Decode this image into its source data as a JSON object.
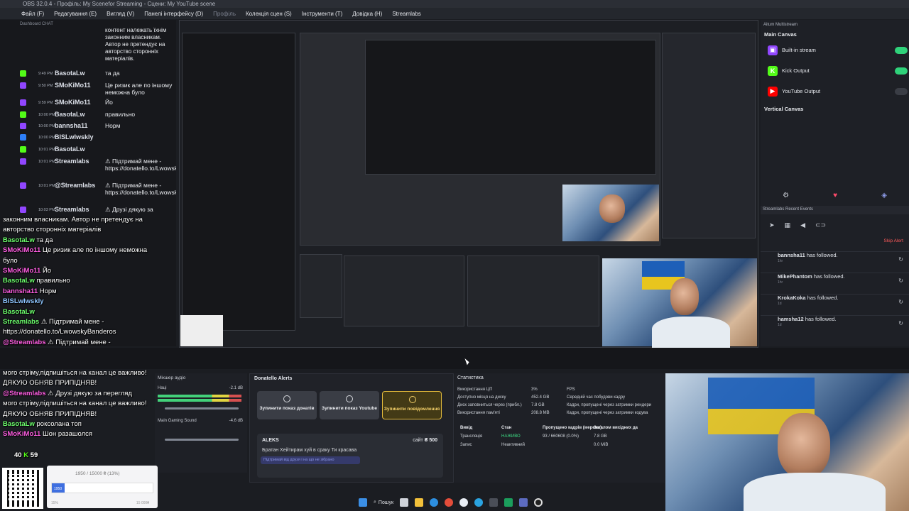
{
  "window": {
    "title": "OBS 32.0.4 - Профіль: My Scenefor Streaming - Сцени: My YouTube scene"
  },
  "menu": {
    "items": [
      "Файл (F)",
      "Редагування (E)",
      "Вигляд (V)",
      "Панелі інтерфейсу (D)",
      "Профіль",
      "Колекція сцен (S)",
      "Інструменти (T)",
      "Довідка (H)",
      "Streamlabs"
    ]
  },
  "chat_dock": {
    "title": "Dashboard CHAT",
    "top_text": "контент належать їхнім законним власникам. Автор не претендує на авторство сторонніх матеріалів.",
    "messages": [
      {
        "time": "9:49 PM",
        "user": "BasotaLw",
        "msg": "та да",
        "icon": "kick"
      },
      {
        "time": "9:50 PM",
        "user": "SMoKiMo11",
        "msg": "Це ризик але по іншому неможна було",
        "icon": "twitch"
      },
      {
        "time": "9:59 PM",
        "user": "SMoKiMo11",
        "msg": "Йо",
        "icon": "twitch"
      },
      {
        "time": "10:00 PM",
        "user": "BasotaLw",
        "msg": "правильно",
        "icon": "kick"
      },
      {
        "time": "10:00 PM",
        "user": "bannsha11",
        "msg": "Норм",
        "icon": "twitch"
      },
      {
        "time": "10:00 PM",
        "user": "BISLwIwskly",
        "msg": "",
        "icon": "blue"
      },
      {
        "time": "10:01 PM",
        "user": "BasotaLw",
        "msg": "",
        "icon": "kick"
      },
      {
        "time": "10:01 PM",
        "user": "Streamlabs",
        "msg": "⚠ Підтримай мене - https://donatello.to/LwowskyBanderos",
        "icon": "twitch"
      },
      {
        "time": "10:01 PM",
        "user": "@Streamlabs",
        "msg": "⚠ Підтримай мене - https://donatello.to/LwowskyBanderos",
        "icon": "twitch"
      },
      {
        "time": "10:03 PM",
        "user": "Streamlabs",
        "msg": "⚠ Друзі дякую за",
        "icon": "twitch"
      }
    ]
  },
  "overlay_chat": {
    "lines": [
      {
        "user": "",
        "msg": "законним власникам. Автор не претендує на",
        "cls": ""
      },
      {
        "user": "",
        "msg": "авторство сторонніх матеріалів",
        "cls": ""
      },
      {
        "user": "BasotaLw",
        "msg": "та да",
        "cls": "g"
      },
      {
        "user": "SMoKiMo11",
        "msg": "Це ризик але по іншому неможна",
        "cls": ""
      },
      {
        "user": "",
        "msg": "було",
        "cls": ""
      },
      {
        "user": "SMoKiMo11",
        "msg": "Йо",
        "cls": ""
      },
      {
        "user": "BasotaLw",
        "msg": "правильно",
        "cls": "g"
      },
      {
        "user": "bannsha11",
        "msg": "Норм",
        "cls": ""
      },
      {
        "user": "BISLwIwskly",
        "msg": "",
        "cls": "b"
      },
      {
        "user": "BasotaLw",
        "msg": "",
        "cls": "g"
      },
      {
        "user": "Streamlabs",
        "msg": "⚠ Підтримай мене -",
        "cls": "g"
      },
      {
        "user": "",
        "msg": "https://donatello.to/LwowskyBanderos",
        "cls": ""
      },
      {
        "user": "@Streamlabs",
        "msg": "⚠ Підтримай мене -",
        "cls": ""
      },
      {
        "user": "",
        "msg": "https://donatello.to/LwowskyBanderos",
        "cls": ""
      },
      {
        "user": "Streamlabs",
        "msg": "⚠ Друзі дякую за перегляд",
        "cls": "g"
      },
      {
        "user": "",
        "msg": "мого стріму,підпишіться на канал це важливо!",
        "cls": ""
      },
      {
        "user": "",
        "msg": "ДЯКУЮ ОБНЯВ ПРИПІДНЯВ!",
        "cls": ""
      },
      {
        "user": "@Streamlabs",
        "msg": "⚠ Друзі дякую за перегляд",
        "cls": ""
      },
      {
        "user": "",
        "msg": "мого стріму,підпишіться на канал це важливо!",
        "cls": ""
      },
      {
        "user": "",
        "msg": "ДЯКУЮ ОБНЯВ ПРИПІДНЯВ!",
        "cls": ""
      },
      {
        "user": "BasotaLw",
        "msg": "роксолана топ",
        "cls": "g"
      },
      {
        "user": "SMoKiMo11",
        "msg": "Шон разашолся",
        "cls": ""
      }
    ],
    "counter_a": "40",
    "counter_b": "59"
  },
  "multistream": {
    "header": "Aitum Multistream",
    "main_canvas": "Main Canvas",
    "outputs": [
      {
        "label": "Built-in stream",
        "icon": "twitch-icon",
        "color": "#9146ff",
        "glyph": "▣"
      },
      {
        "label": "Kick Output",
        "icon": "kick-icon",
        "color": "#53fc18",
        "glyph": "K"
      },
      {
        "label": "YouTube Output",
        "icon": "youtube-icon",
        "color": "#ff0000",
        "glyph": "▶"
      }
    ],
    "vertical_canvas": "Vertical Canvas"
  },
  "recent_events": {
    "header": "Streamlabs Recent Events",
    "skip": "Skip Alert",
    "items": [
      {
        "user": "bannsha11",
        "text": "has followed.",
        "sub": "1hr"
      },
      {
        "user": "MikePhantom",
        "text": "has followed.",
        "sub": "1hr"
      },
      {
        "user": "KrokaKoka",
        "text": "has followed.",
        "sub": "1d"
      },
      {
        "user": "hamsha12",
        "text": "has followed.",
        "sub": "1d"
      }
    ]
  },
  "mixer": {
    "title": "Мікшер аудіо",
    "channels": [
      {
        "name": "Наці",
        "db": "-2.1 dB"
      },
      {
        "name": "Main Gaming Sound",
        "db": "-4.6 dB"
      }
    ]
  },
  "donatello": {
    "title": "Donatello Alerts",
    "buttons": [
      "Зупинити показ донатів",
      "Зупинити показ Youtube",
      "Зупинити повідомлення"
    ],
    "card": {
      "name": "ALEKS",
      "amount_prefix": "сайт",
      "amount": "₴ 500",
      "message": "Братан Хейтирам хуй в сраку Ти красава",
      "pill": "Підтримай від друзя і на що не зібрано"
    }
  },
  "stats": {
    "title": "Статистика",
    "rows": [
      {
        "label": "Використання ЦП",
        "value": "3%"
      },
      {
        "label": "Доступно місця на диску",
        "value": "452.4 GB"
      },
      {
        "label": "Диск заповниться через (прибл.)",
        "value": "7.8 GB"
      },
      {
        "label": "Використання пам'яті",
        "value": "208.8 MB"
      }
    ],
    "right": [
      "FPS",
      "Середній час побудови кадру",
      "Кадри, пропущені через затримки рендери",
      "Кадри, пропущені через затримки кодува"
    ],
    "table_headers": [
      "Вивід",
      "Стан",
      "Пропущено кадрів (мережа)",
      "Загалом вихідних да"
    ],
    "table_rows": [
      {
        "out": "Трансляція",
        "state": "НАЖИВО",
        "dropped": "93 / 660608 (0.0%)",
        "total": "7.8 GB"
      },
      {
        "out": "Запис",
        "state": "Неактивний",
        "dropped": "",
        "total": "0.0 MiB"
      }
    ]
  },
  "goal": {
    "text": "1950 / 15000 ₴ (13%)",
    "progress": 0.13,
    "fill_label": "1950",
    "low": "15%",
    "high": "15 000₴"
  },
  "taskbar": {
    "search": "Пошук"
  },
  "colors": {
    "kick": "#53fc18",
    "twitch": "#9146ff",
    "live": "#3ddc84",
    "alert": "#ff5a5a"
  }
}
